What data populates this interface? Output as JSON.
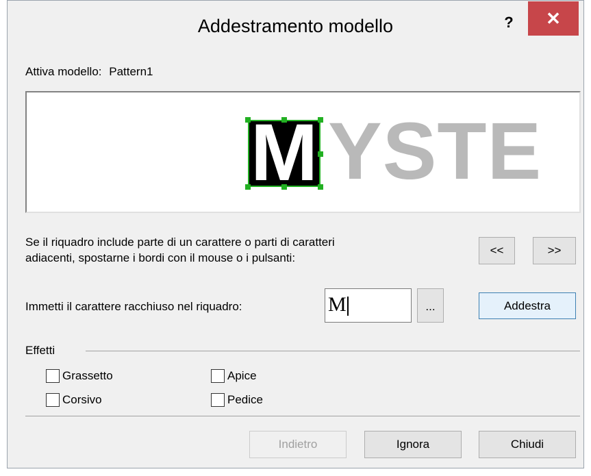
{
  "window": {
    "title": "Addestramento modello",
    "help_label": "?",
    "close_label": "✕"
  },
  "active_pattern": {
    "label": "Attiva modello:",
    "value": "Pattern1"
  },
  "preview": {
    "selected_char": "M",
    "remaining_text": "YSTE"
  },
  "instructions": {
    "line1": "Se il riquadro include parte di un carattere o parti di caratteri",
    "line2": "adiacenti, spostarne i bordi con il mouse o i pulsanti:"
  },
  "nav": {
    "prev_label": "<<",
    "next_label": ">>"
  },
  "char_entry": {
    "label": "Immetti il carattere racchiuso nel riquadro:",
    "value": "M",
    "browse_label": "...",
    "train_label": "Addestra"
  },
  "effects": {
    "heading": "Effetti",
    "options": [
      {
        "label": "Grassetto",
        "checked": false
      },
      {
        "label": "Corsivo",
        "checked": false
      },
      {
        "label": "Apice",
        "checked": false
      },
      {
        "label": "Pedice",
        "checked": false
      }
    ]
  },
  "footer": {
    "back_label": "Indietro",
    "ignore_label": "Ignora",
    "close_label": "Chiudi"
  },
  "colors": {
    "close_button": "#c7464a",
    "selection_border": "#22b022",
    "preview_text": "#b9b9b9"
  }
}
